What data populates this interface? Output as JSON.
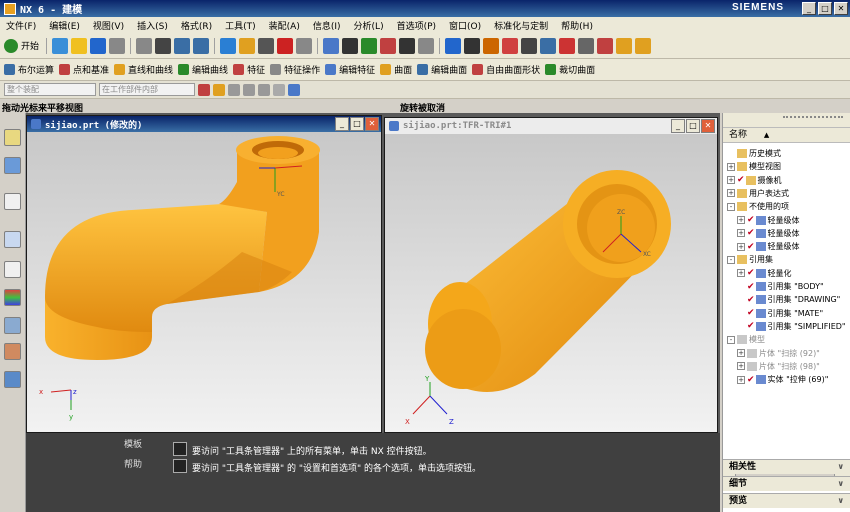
{
  "window": {
    "title": "NX 6 - 建模",
    "brand": "SIEMENS",
    "buttons": [
      "_",
      "□",
      "✕"
    ]
  },
  "menu": [
    "文件(F)",
    "编辑(E)",
    "视图(V)",
    "插入(S)",
    "格式(R)",
    "工具(T)",
    "装配(A)",
    "信息(I)",
    "分析(L)",
    "首选项(P)",
    "窗口(O)",
    "标准化与定制",
    "帮助(H)"
  ],
  "toolbar1": {
    "start_label": "开始",
    "colors": [
      "#3a8fd8",
      "#f0c020",
      "#2266cc",
      "#888888",
      "#888888",
      "#444444",
      "#3a6ea5",
      "#3a6ea5",
      "#2a7fd4",
      "#e0a020",
      "#555555",
      "#cc2222",
      "#888888",
      "#4a78c8",
      "#333333",
      "#2a8a2a",
      "#c04040",
      "#333333",
      "#888888",
      "#2266cc",
      "#333333",
      "#cc6600",
      "#d04040",
      "#444444",
      "#3a6ea5",
      "#cc3333",
      "#666666",
      "#c04040",
      "#e0a020",
      "#e0a020"
    ]
  },
  "toolbar2": {
    "items": [
      "布尔运算",
      "点和基准",
      "直线和曲线",
      "编辑曲线",
      "特征",
      "特征操作",
      "编辑特征",
      "曲面",
      "编辑曲面",
      "自由曲面形状",
      "裁切曲面"
    ]
  },
  "toolbar3": {
    "combo1": "整个装配",
    "combo2": "在工作部件内部"
  },
  "status": {
    "left": "拖动光标来平移视图",
    "right": "旋转被取消"
  },
  "viewport1": {
    "title": "sijiao.prt  (修改的)"
  },
  "viewport2": {
    "title": "sijiao.prt:TFR-TRI#1"
  },
  "axes": {
    "x": "x",
    "y": "y",
    "z": "z",
    "xc": "XC",
    "yc": "YC",
    "zc": "ZC",
    "X": "X",
    "Y": "Y",
    "Z": "Z"
  },
  "messages": {
    "label1": "模板",
    "label2": "帮助",
    "line1": "要访问 \"工具条管理器\" 上的所有菜单，单击 NX 控件按钮。",
    "line2": "要访问 \"工具条管理器\" 的 \"设置和首选项\" 的各个选项，单击选项按钮。"
  },
  "navigator": {
    "column": "名称",
    "tree": [
      {
        "label": "历史模式",
        "exp": "",
        "chk": false,
        "indent": 0,
        "gray": false
      },
      {
        "label": "模型视图",
        "exp": "+",
        "chk": false,
        "indent": 0,
        "gray": false
      },
      {
        "label": "摄像机",
        "exp": "+",
        "chk": true,
        "indent": 0,
        "gray": false
      },
      {
        "label": "用户表达式",
        "exp": "+",
        "chk": false,
        "indent": 0,
        "gray": false
      },
      {
        "label": "不使用的项",
        "exp": "-",
        "chk": false,
        "indent": 0,
        "gray": false
      },
      {
        "label": "轻量级体",
        "exp": "+",
        "chk": true,
        "indent": 1,
        "gray": false
      },
      {
        "label": "轻量级体",
        "exp": "+",
        "chk": true,
        "indent": 1,
        "gray": false
      },
      {
        "label": "轻量级体",
        "exp": "+",
        "chk": true,
        "indent": 1,
        "gray": false
      },
      {
        "label": "引用集",
        "exp": "-",
        "chk": false,
        "indent": 0,
        "gray": false
      },
      {
        "label": "轻量化",
        "exp": "+",
        "chk": true,
        "indent": 1,
        "gray": false
      },
      {
        "label": "引用集 \"BODY\"",
        "exp": "",
        "chk": true,
        "indent": 1,
        "gray": false
      },
      {
        "label": "引用集 \"DRAWING\"",
        "exp": "",
        "chk": true,
        "indent": 1,
        "gray": false
      },
      {
        "label": "引用集 \"MATE\"",
        "exp": "",
        "chk": true,
        "indent": 1,
        "gray": false
      },
      {
        "label": "引用集 \"SIMPLIFIED\"",
        "exp": "",
        "chk": true,
        "indent": 1,
        "gray": false
      },
      {
        "label": "模型",
        "exp": "-",
        "chk": false,
        "indent": 0,
        "gray": true
      },
      {
        "label": "片体 \"扫掠 (92)\"",
        "exp": "+",
        "chk": false,
        "indent": 1,
        "gray": true
      },
      {
        "label": "片体 \"扫掠 (98)\"",
        "exp": "+",
        "chk": false,
        "indent": 1,
        "gray": true
      },
      {
        "label": "实体 \"拉伸 (69)\"",
        "exp": "+",
        "chk": true,
        "indent": 1,
        "gray": false
      }
    ],
    "sections": [
      "相关性",
      "细节",
      "预览"
    ]
  },
  "colors": {
    "accent": "#0a246a",
    "pipe": "#f4a71a",
    "pipe_dark": "#c87a08",
    "check": "#cc0020"
  }
}
